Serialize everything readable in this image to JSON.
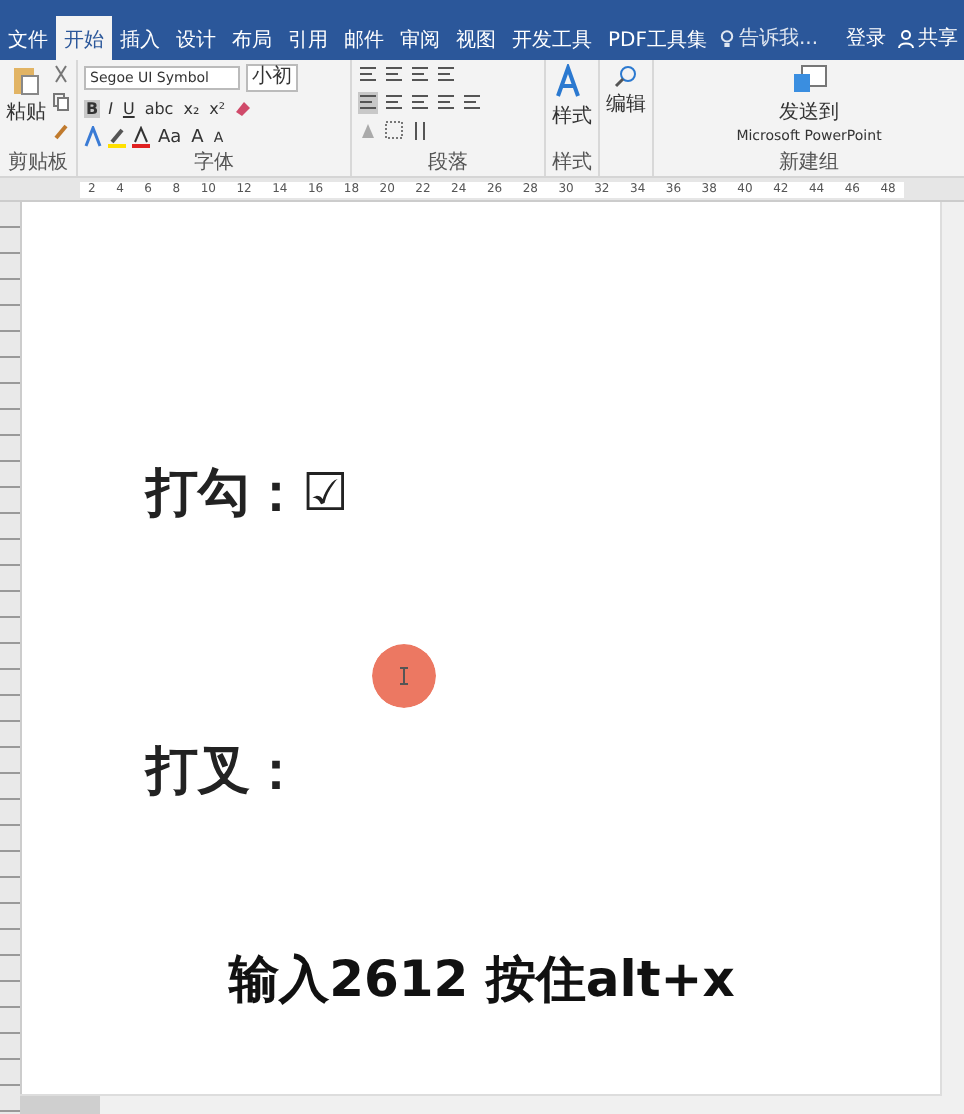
{
  "tabs": [
    {
      "label": "文件",
      "selected": false
    },
    {
      "label": "开始",
      "selected": true
    },
    {
      "label": "插入",
      "selected": false
    },
    {
      "label": "设计",
      "selected": false
    },
    {
      "label": "布局",
      "selected": false
    },
    {
      "label": "引用",
      "selected": false
    },
    {
      "label": "邮件",
      "selected": false
    },
    {
      "label": "审阅",
      "selected": false
    },
    {
      "label": "视图",
      "selected": false
    },
    {
      "label": "开发工具",
      "selected": false
    },
    {
      "label": "PDF工具集",
      "selected": false
    }
  ],
  "tell_me": {
    "placeholder": "告诉我..."
  },
  "account": {
    "sign_in": "登录",
    "share": "共享"
  },
  "ribbon": {
    "clipboard": {
      "paste": "粘贴",
      "label": "剪贴板"
    },
    "font": {
      "name": "Segoe UI Symbol",
      "size": "小初",
      "row1": [
        "B",
        "I",
        "U",
        "abc",
        "x₂",
        "x²"
      ],
      "row2": [
        "Aa",
        "A",
        "A"
      ],
      "label": "字体"
    },
    "paragraph": {
      "label": "段落"
    },
    "styles": {
      "button": "样式",
      "label": "样式"
    },
    "editing": {
      "button": "编辑"
    },
    "new_group": {
      "line1": "发送到",
      "line2": "Microsoft PowerPoint",
      "label": "新建组"
    }
  },
  "ruler": [
    "2",
    "4",
    "6",
    "8",
    "10",
    "12",
    "14",
    "16",
    "18",
    "20",
    "22",
    "24",
    "26",
    "28",
    "30",
    "32",
    "34",
    "36",
    "38",
    "40",
    "42",
    "44",
    "46",
    "48"
  ],
  "document": {
    "lines": [
      {
        "label": "打勾：",
        "symbol": "☑"
      },
      {
        "label": "打叉："
      }
    ]
  },
  "caption": "输入2612 按住alt+x"
}
